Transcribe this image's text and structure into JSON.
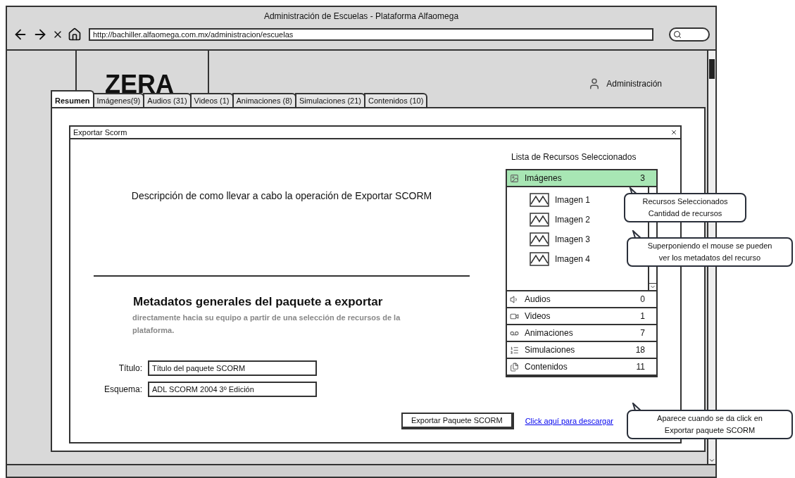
{
  "window": {
    "title": "Administración de Escuelas - Plataforma Alfaomega",
    "url": "http://bachiller.alfaomega.com.mx/administracion/escuelas"
  },
  "app": {
    "logo": "ZERA",
    "user": "Administración"
  },
  "tabs": [
    {
      "label": "Resumen",
      "selected": true
    },
    {
      "label": "Imágenes(9)",
      "selected": false
    },
    {
      "label": "Audios (31)",
      "selected": false
    },
    {
      "label": "Videos (1)",
      "selected": false
    },
    {
      "label": "Animaciones (8)",
      "selected": false
    },
    {
      "label": "Simulaciones (21)",
      "selected": false
    },
    {
      "label": "Contenidos (10)",
      "selected": false
    }
  ],
  "dialog": {
    "title": "Exportar Scorm",
    "description": "Descripción de como llevar a cabo la operación de Exportar SCORM",
    "heading": "Metadatos generales del paquete a exportar",
    "subtext": "directamente hacia su equipo a partir de una selección de recursos de la plataforma.",
    "fields": [
      {
        "label": "Título:",
        "value": "Título del paquete SCORM"
      },
      {
        "label": "Esquema:",
        "value": "ADL SCORM 2004 3º Edición"
      }
    ],
    "export_button": "Exportar Paquete SCORM",
    "download_link": "Click aquí para descargar"
  },
  "resources": {
    "title": "Lista de Recursos Seleccionados",
    "categories": [
      {
        "kind": "images",
        "label": "Imágenes",
        "count": "3",
        "expanded": true,
        "children": [
          {
            "label": "Imagen 1"
          },
          {
            "label": "Imagen 2"
          },
          {
            "label": "Imagen 3"
          },
          {
            "label": "Imagen 4"
          }
        ]
      },
      {
        "kind": "audio",
        "label": "Audios",
        "count": "0",
        "expanded": false
      },
      {
        "kind": "video",
        "label": "Videos",
        "count": "1",
        "expanded": false
      },
      {
        "kind": "animation",
        "label": "Animaciones",
        "count": "7",
        "expanded": false
      },
      {
        "kind": "simulation",
        "label": "Simulaciones",
        "count": "18",
        "expanded": false
      },
      {
        "kind": "content",
        "label": "Contenidos",
        "count": "11",
        "expanded": false
      }
    ]
  },
  "callouts": [
    {
      "lines": [
        "Recursos Seleccionados",
        "Cantidad de recursos"
      ]
    },
    {
      "lines": [
        "Superponiendo el mouse se pueden",
        "ver los metadatos del recurso"
      ]
    },
    {
      "lines": [
        "Aparece cuando se da click en",
        "Exportar paquete SCORM"
      ]
    }
  ]
}
